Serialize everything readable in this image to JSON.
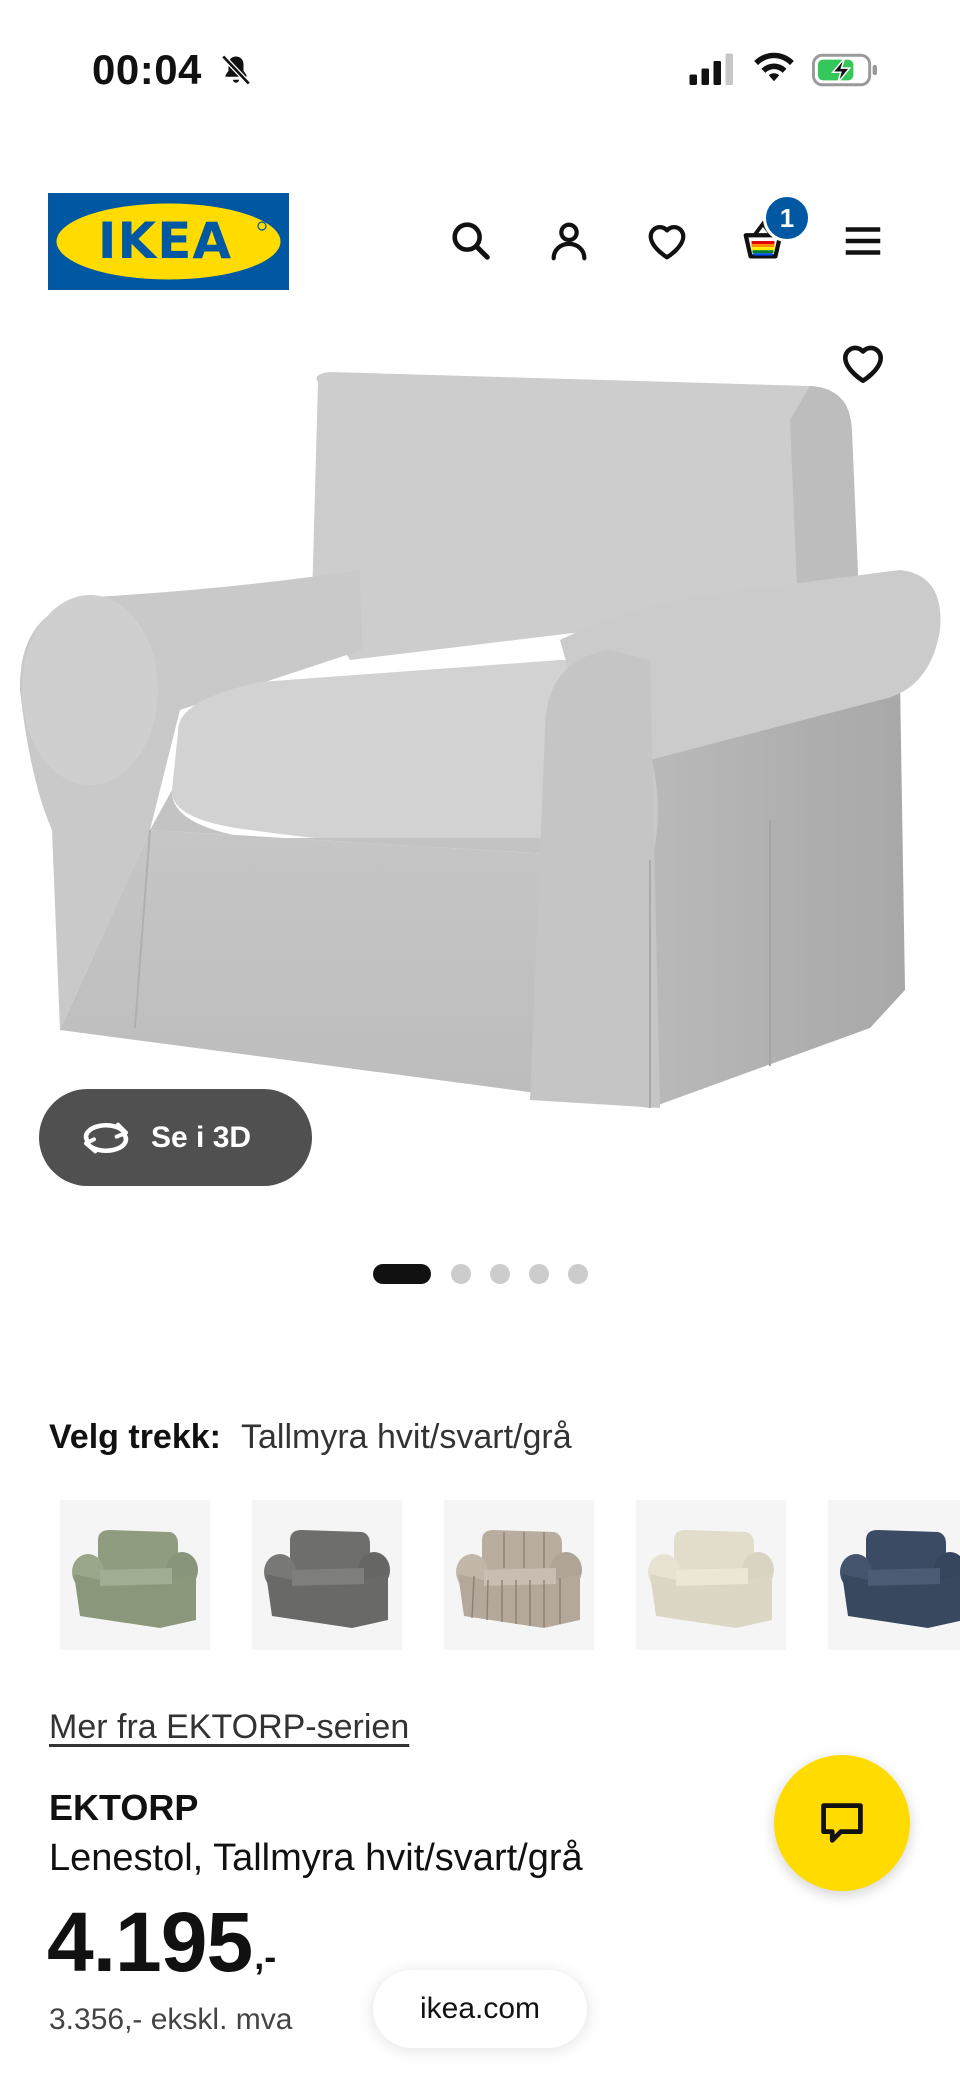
{
  "status_bar": {
    "time": "00:04",
    "icons": [
      "bell-muted-icon",
      "cellular-signal-icon",
      "wifi-icon",
      "battery-charging-icon"
    ]
  },
  "header": {
    "logo_text": "IKEA",
    "brand_colors": {
      "blue": "#0058a3",
      "yellow": "#ffdb00"
    },
    "icons": [
      "search-icon",
      "account-icon",
      "heart-icon",
      "cart-icon",
      "menu-icon"
    ],
    "cart_count": "1"
  },
  "gallery": {
    "view_3d_label": "Se i 3D",
    "image_count": 5,
    "active_index": 0
  },
  "cover": {
    "label": "Velg trekk:",
    "value": "Tallmyra hvit/svart/grå",
    "swatch_colors": [
      "#8f9c80",
      "#6e6e6c",
      "#b9ada0",
      "#e2dccb",
      "#3a4b63"
    ]
  },
  "product": {
    "series_link": "Mer fra EKTORP-serien",
    "name": "EKTORP",
    "description": "Lenestol, Tallmyra hvit/svart/grå",
    "price": "4.195",
    "price_suffix": ",-",
    "price_excl_vat": "3.356,- ekskl. mva"
  },
  "browser": {
    "url": "ikea.com"
  }
}
